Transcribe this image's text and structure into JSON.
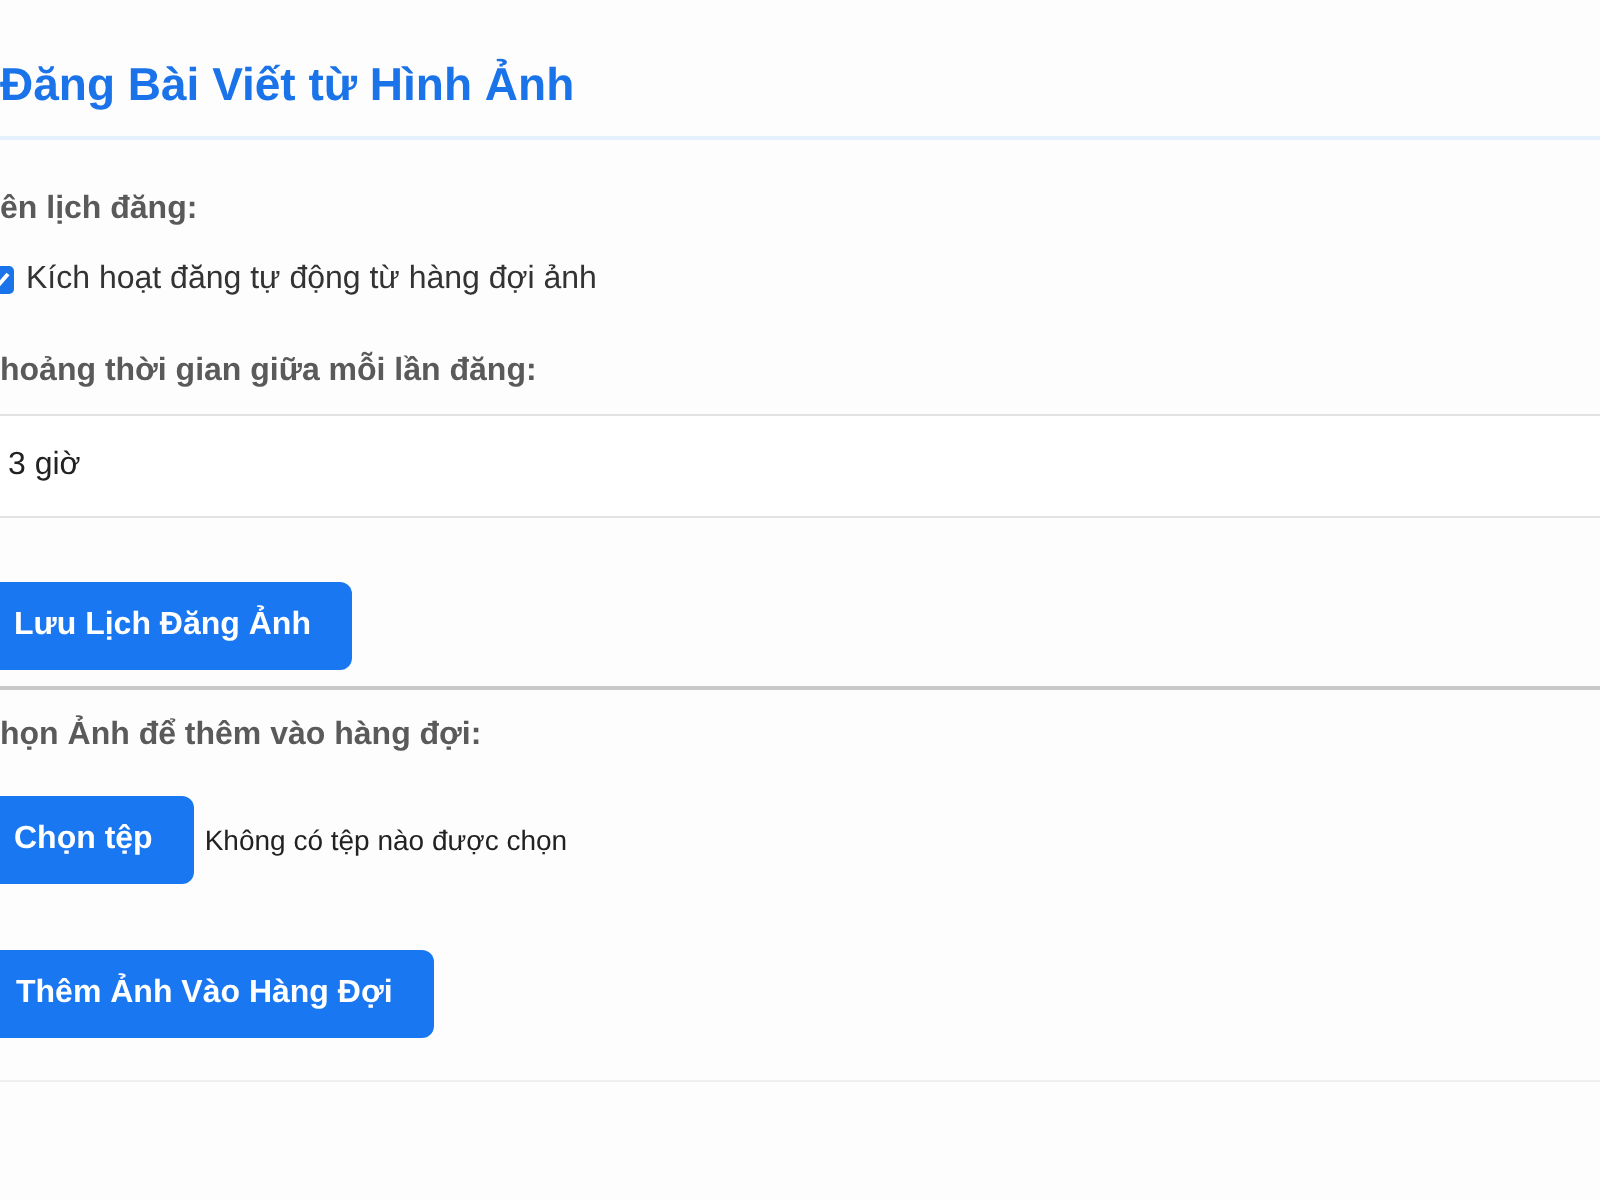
{
  "header": {
    "title": "Đăng Bài Viết từ Hình Ảnh"
  },
  "schedule": {
    "label": "ên lịch đăng:",
    "auto_post": {
      "label": "Kích hoạt đăng tự động từ hàng đợi ảnh",
      "checked": true
    },
    "interval": {
      "label": "hoảng thời gian giữa mỗi lần đăng:",
      "value": "3 giờ"
    },
    "save_button": "Lưu Lịch Đăng Ảnh"
  },
  "upload": {
    "label": "họn Ảnh để thêm vào hàng đợi:",
    "file_button": "Chọn tệp",
    "file_status": "Không có tệp nào được chọn",
    "add_button": "Thêm Ảnh Vào Hàng Đợi"
  }
}
